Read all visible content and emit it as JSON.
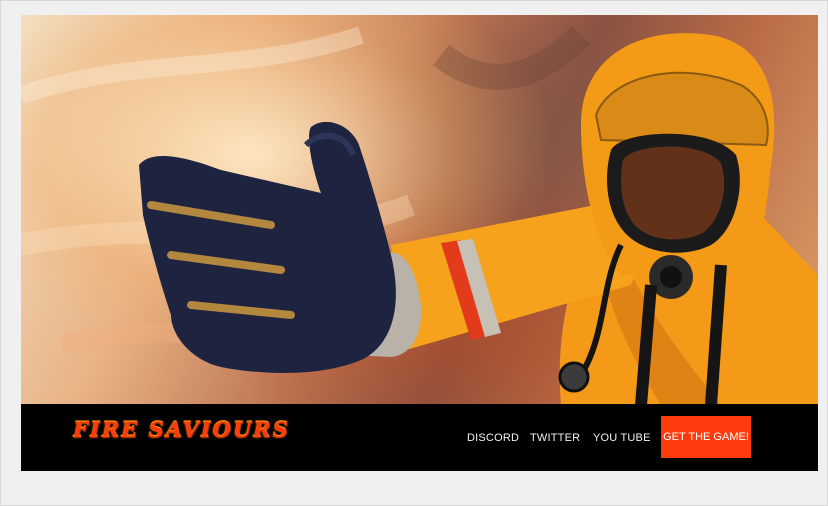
{
  "hero": {
    "image": "firefighter-photo",
    "accent_colors": {
      "suit": "#f59d1a",
      "glove": "#1f2540",
      "flame": "#f2c08e",
      "smoke": "#7e4b3d"
    }
  },
  "navbar": {
    "brand": "FIRE SAVIOURS",
    "links": [
      "DISCORD",
      "TWITTER",
      "YOU TUBE"
    ],
    "cta_label": "GET THE GAME!",
    "colors": {
      "background": "#000000",
      "brand": "#ff3a10",
      "cta": "#ff3b0d",
      "link_text": "#f2f2f2"
    }
  }
}
